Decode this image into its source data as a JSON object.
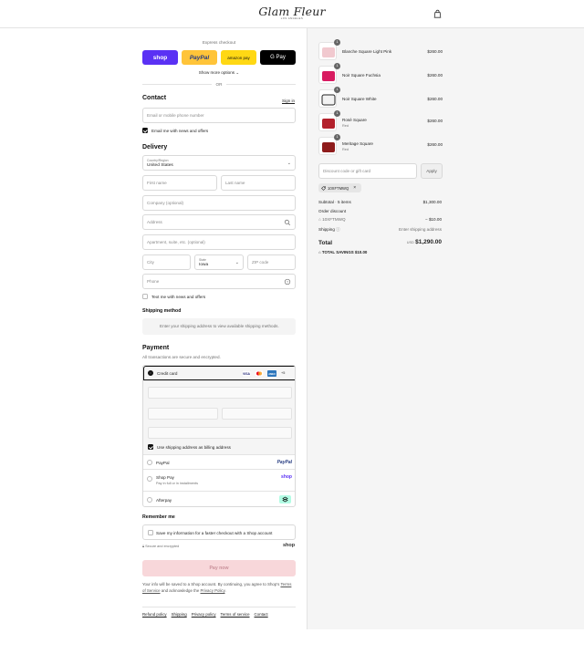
{
  "header": {
    "logo_name": "Glam Fleur",
    "logo_sub": "LOS ANGELES"
  },
  "express": {
    "title": "Express checkout",
    "shop": "shop",
    "paypal": "PayPal",
    "amazon": "amazon pay",
    "gpay": "G Pay",
    "more_options": "Show more options",
    "or": "OR"
  },
  "contact": {
    "title": "Contact",
    "sign_in": "Sign in",
    "email_placeholder": "Email or mobile phone number",
    "news_label": "Email me with news and offers"
  },
  "delivery": {
    "title": "Delivery",
    "country_label": "Country/Region",
    "country_value": "United States",
    "first_name": "First name",
    "last_name": "Last name",
    "company": "Company (optional)",
    "address": "Address",
    "apartment": "Apartment, suite, etc. (optional)",
    "city": "City",
    "state_label": "State",
    "state_value": "Iowa",
    "zip": "ZIP code",
    "phone": "Phone",
    "text_label": "Text me with news and offers"
  },
  "shipping": {
    "title": "Shipping method",
    "message": "Enter your shipping address to view available shipping methods."
  },
  "payment": {
    "title": "Payment",
    "subtitle": "All transactions are secure and encrypted.",
    "credit_card": "Credit card",
    "more_cards": "+5",
    "billing_label": "Use shipping address as billing address",
    "paypal": "PayPal",
    "paypal_logo": "PayPal",
    "shop_pay": "Shop Pay",
    "shop_pay_sub": "Pay in full or in installments",
    "shop_logo": "shop",
    "afterpay": "Afterpay"
  },
  "remember": {
    "title": "Remember me",
    "label": "Save my information for a faster checkout with a Shop account",
    "secure": "Secure and encrypted",
    "shop_logo": "shop"
  },
  "pay_now": "Pay now",
  "legal": {
    "text1": "Your info will be saved to a Shop account. By continuing, you agree to Shop's",
    "terms": "Terms of Service",
    "text2": "and acknowledge the",
    "privacy": "Privacy Policy",
    "end": "."
  },
  "footer": [
    "Refund policy",
    "Shipping",
    "Privacy policy",
    "Terms of service",
    "Contact"
  ],
  "products": [
    {
      "name": "Blanche Square Light Pink",
      "variant": "",
      "price": "$260.00",
      "qty": "1",
      "color": "#f1c9cf"
    },
    {
      "name": "Noir Square Fuchsia",
      "variant": "",
      "price": "$260.00",
      "qty": "1",
      "color": "#d81b60"
    },
    {
      "name": "Noir Square White",
      "variant": "",
      "price": "$260.00",
      "qty": "1",
      "color": "#f2f2f2"
    },
    {
      "name": "Rosé Square",
      "variant": "Red",
      "price": "$260.00",
      "qty": "1",
      "color": "#b3202b"
    },
    {
      "name": "Meritage Square",
      "variant": "Red",
      "price": "$260.00",
      "qty": "1",
      "color": "#8e1b1b"
    }
  ],
  "discount": {
    "placeholder": "Discount code or gift card",
    "apply": "Apply",
    "code": "10XFTMWQ"
  },
  "summary": {
    "subtotal_label": "Subtotal · 5 items",
    "subtotal_value": "$1,300.00",
    "order_discount": "Order discount",
    "code": "10XFTMWQ",
    "discount_value": "− $10.00",
    "shipping_label": "Shipping",
    "shipping_value": "Enter shipping address",
    "total_label": "Total",
    "currency": "USD",
    "total_value": "$1,290.00",
    "savings": "TOTAL SAVINGS $10.00"
  }
}
